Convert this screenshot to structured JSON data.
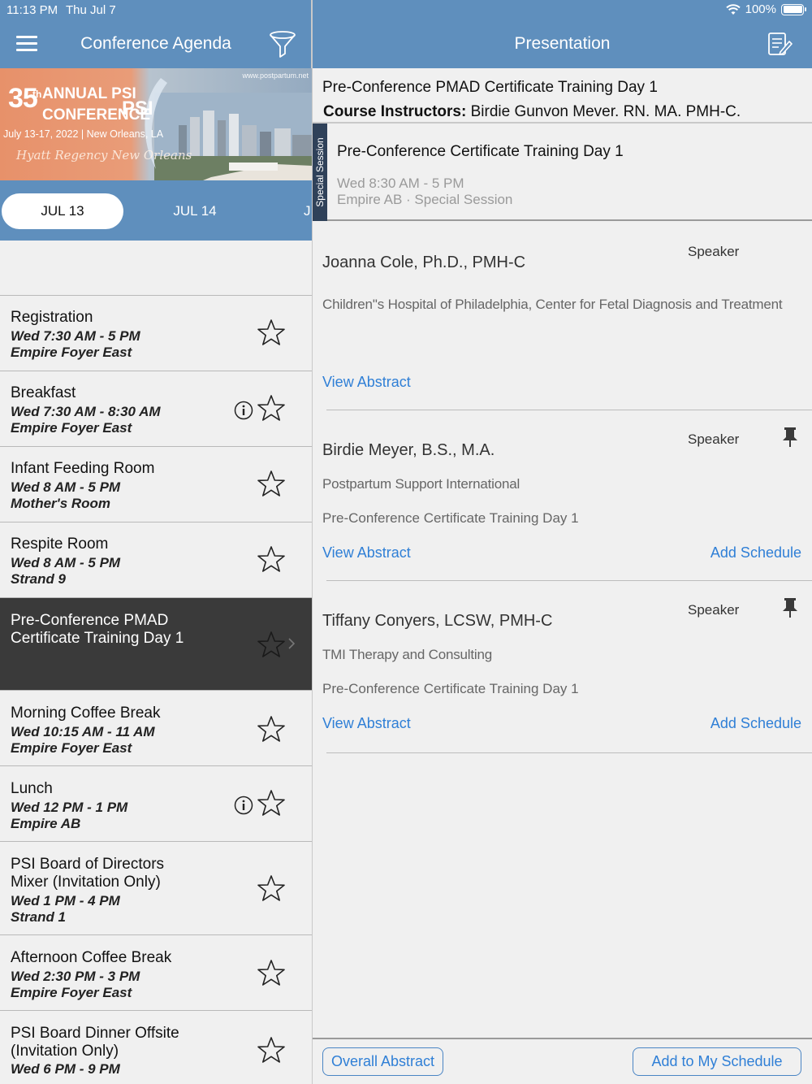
{
  "status": {
    "time": "11:13 PM",
    "date": "Thu Jul 7",
    "battery": "100%"
  },
  "left_header": {
    "title": "Conference Agenda",
    "menu_icon": "hamburger-menu-icon",
    "filter_icon": "filter-funnel-icon"
  },
  "right_header": {
    "title": "Presentation",
    "notes_icon": "notes-edit-icon"
  },
  "banner": {
    "number": "35",
    "suffix": "th",
    "line1": "ANNUAL PSI",
    "line2": "CONFERENCE",
    "logo": "PSI",
    "dates": "July 13-17, 2022 | New Orleans, LA",
    "script": "Hyatt Regency New Orleans",
    "url": "www.postpartum.net"
  },
  "date_tabs": [
    {
      "label": "JUL 13",
      "selected": true
    },
    {
      "label": "JUL 14",
      "selected": false
    },
    {
      "label": "J",
      "selected": false
    }
  ],
  "agenda": [
    {
      "title": "Registration",
      "time": "Wed 7:30 AM - 5 PM",
      "room": "Empire Foyer East",
      "info": false
    },
    {
      "title": "Breakfast",
      "time": "Wed 7:30 AM - 8:30 AM",
      "room": "Empire Foyer East",
      "info": true
    },
    {
      "title": "Infant Feeding Room",
      "time": "Wed 8 AM - 5 PM",
      "room": "Mother's Room",
      "info": false
    },
    {
      "title": "Respite Room",
      "time": "Wed 8 AM - 5 PM",
      "room": "Strand 9",
      "info": false
    },
    {
      "title_line1": "Pre-Conference PMAD",
      "title_line2": "Certificate Training Day 1",
      "selected": true
    },
    {
      "title": "Morning Coffee Break",
      "time": "Wed 10:15 AM - 11 AM",
      "room": "Empire Foyer East",
      "info": false
    },
    {
      "title": "Lunch",
      "time": "Wed 12 PM - 1 PM",
      "room": "Empire AB",
      "info": true
    },
    {
      "title_line1": "PSI Board of Directors",
      "title_line2": "Mixer (Invitation Only)",
      "time": "Wed 1 PM - 4 PM",
      "room": "Strand 1"
    },
    {
      "title": "Afternoon Coffee Break",
      "time": "Wed 2:30 PM - 3 PM",
      "room": "Empire Foyer East"
    },
    {
      "title_line1": "PSI Board Dinner Offsite",
      "title_line2": "(Invitation Only)",
      "time": "Wed 6 PM - 9 PM"
    }
  ],
  "presentation": {
    "title": "Pre-Conference PMAD Certificate Training Day 1",
    "instructors_label": "Course Instructors:",
    "instructors": "Birdie Gunvon Mever. RN. MA. PMH-C."
  },
  "session": {
    "tag": "Special Session",
    "title": "Pre-Conference Certificate Training Day 1",
    "time": "Wed 8:30 AM - 5 PM",
    "location": "Empire AB · Special Session"
  },
  "speakers": [
    {
      "name": "Joanna Cole, Ph.D., PMH-C",
      "role": "Speaker",
      "affiliation": "Children''s Hospital of Philadelphia, Center for Fetal Diagnosis and Treatment",
      "view_abstract": "View Abstract"
    },
    {
      "name": "Birdie Meyer, B.S., M.A.",
      "role": "Speaker",
      "affiliation": "Postpartum Support International",
      "session": "Pre-Conference Certificate Training Day 1",
      "view_abstract": "View Abstract",
      "add_schedule": "Add Schedule"
    },
    {
      "name": "Tiffany Conyers, LCSW, PMH-C",
      "role": "Speaker",
      "affiliation": "TMI Therapy and Consulting",
      "session": "Pre-Conference Certificate Training Day 1",
      "view_abstract": "View Abstract",
      "add_schedule": "Add Schedule"
    }
  ],
  "bottom": {
    "overall_abstract": "Overall Abstract",
    "add_to_schedule": "Add to My Schedule"
  },
  "colors": {
    "header": "#5f8fbd",
    "link": "#2f7fd6",
    "selected_row": "#3a3a3a",
    "session_tag": "#2f4159"
  }
}
